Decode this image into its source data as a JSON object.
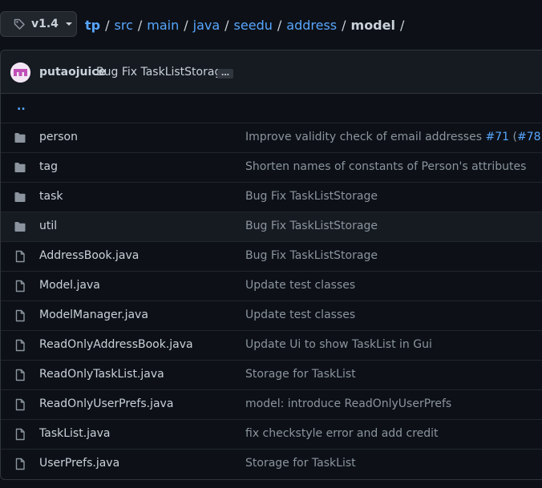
{
  "branch": {
    "label": "v1.4",
    "icon": "tag-icon"
  },
  "breadcrumb": {
    "links": [
      "tp",
      "src",
      "main",
      "java",
      "seedu",
      "address"
    ],
    "current": "model",
    "separator": "/"
  },
  "commit": {
    "author": "putaojuice",
    "message": "Bug Fix TaskListStorage",
    "ellipsis": "…"
  },
  "parent_dir": "..",
  "files": [
    {
      "type": "folder",
      "name": "person",
      "message": "Improve validity check of email addresses ",
      "links": [
        "#71",
        "#78"
      ]
    },
    {
      "type": "folder",
      "name": "tag",
      "message": "Shorten names of constants of Person's attributes"
    },
    {
      "type": "folder",
      "name": "task",
      "message": "Bug Fix TaskListStorage"
    },
    {
      "type": "folder",
      "name": "util",
      "message": "Bug Fix TaskListStorage"
    },
    {
      "type": "file",
      "name": "AddressBook.java",
      "message": "Bug Fix TaskListStorage"
    },
    {
      "type": "file",
      "name": "Model.java",
      "message": "Update test classes"
    },
    {
      "type": "file",
      "name": "ModelManager.java",
      "message": "Update test classes"
    },
    {
      "type": "file",
      "name": "ReadOnlyAddressBook.java",
      "message": "Update Ui to show TaskList in Gui"
    },
    {
      "type": "file",
      "name": "ReadOnlyTaskList.java",
      "message": "Storage for TaskList"
    },
    {
      "type": "file",
      "name": "ReadOnlyUserPrefs.java",
      "message": "model: introduce ReadOnlyUserPrefs"
    },
    {
      "type": "file",
      "name": "TaskList.java",
      "message": "fix checkstyle error and add credit"
    },
    {
      "type": "file",
      "name": "UserPrefs.java",
      "message": "Storage for TaskList"
    }
  ],
  "colors": {
    "background": "#0d1117",
    "link": "#58a6ff",
    "text": "#c9d1d9",
    "muted": "#8b949e",
    "border": "#30363d",
    "icon": "#8b949e"
  }
}
